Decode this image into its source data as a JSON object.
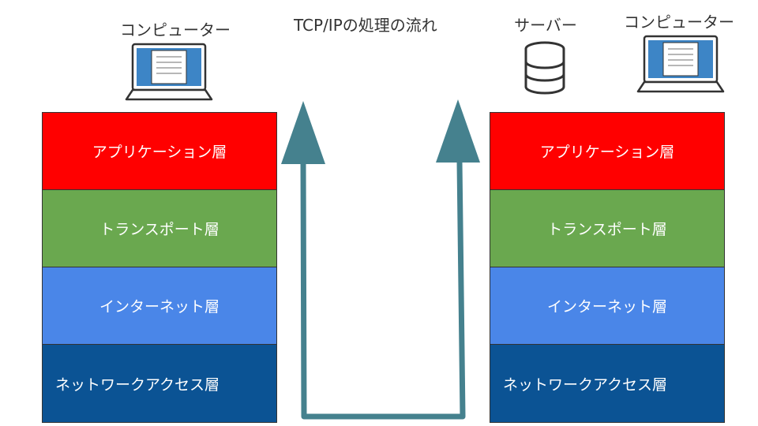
{
  "title": "TCP/IPの処理の流れ",
  "left": {
    "device_label": "コンピューター",
    "layers": [
      "アプリケーション層",
      "トランスポート層",
      "インターネット層",
      "ネットワークアクセス層"
    ]
  },
  "right": {
    "server_label": "サーバー",
    "device_label": "コンピューター",
    "layers": [
      "アプリケーション層",
      "トランスポート層",
      "インターネット層",
      "ネットワークアクセス層"
    ]
  },
  "colors": {
    "application": "#ff0000",
    "transport": "#6aa84f",
    "internet": "#4a86e8",
    "network_access": "#0b5394",
    "arrow": "#45818e"
  },
  "icons": [
    "laptop-icon",
    "database-icon",
    "laptop-icon"
  ]
}
